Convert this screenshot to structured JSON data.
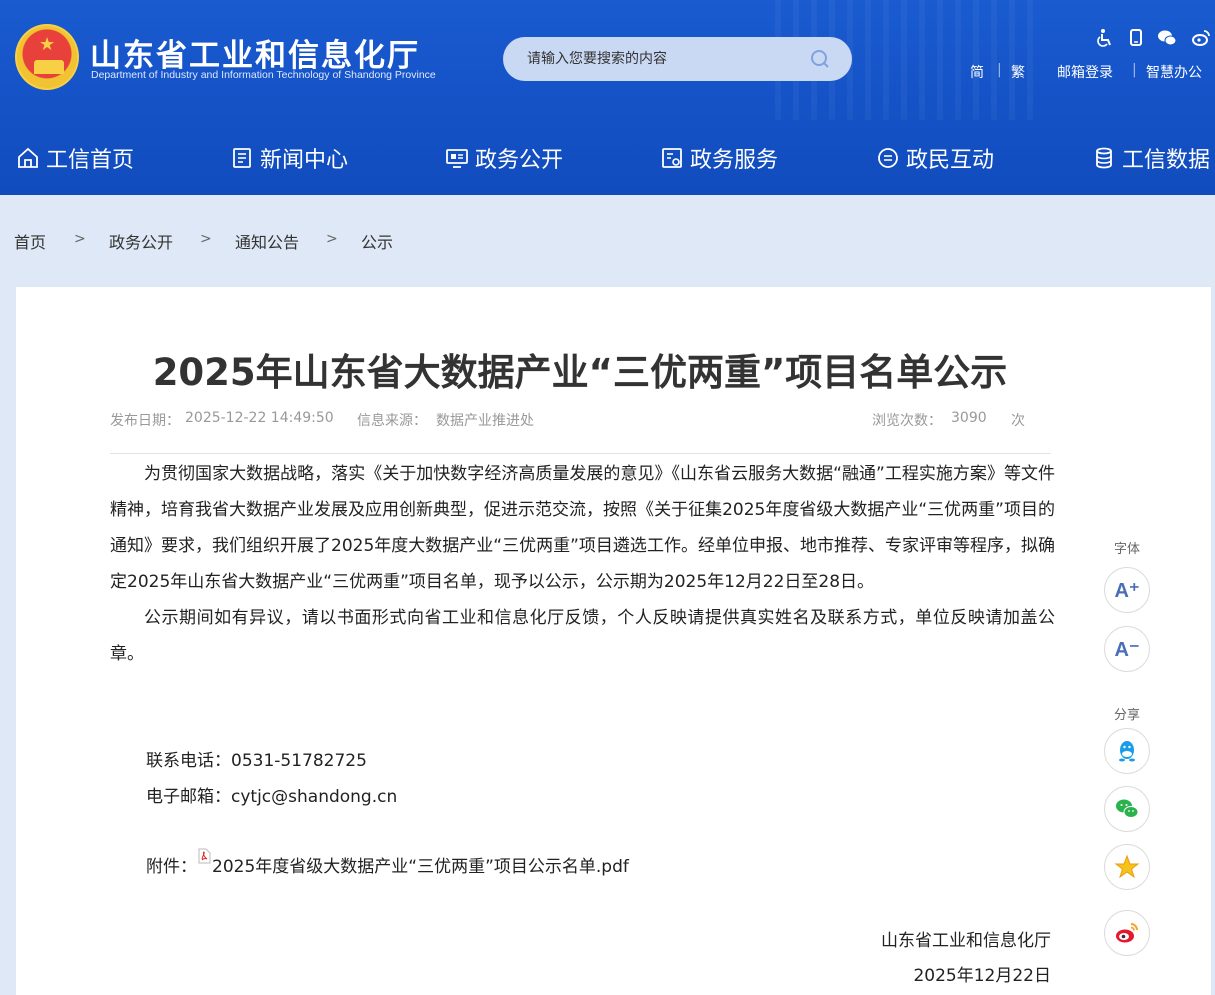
{
  "header": {
    "site_title": "山东省工业和信息化厅",
    "site_subtitle": "Department of Industry and Information Technology of Shandong Province",
    "search_placeholder": "请输入您要搜索的内容",
    "top_icons": [
      "accessibility-icon",
      "mobile-icon",
      "wechat-icon",
      "weibo-icon"
    ],
    "top_links": [
      "简",
      "繁",
      "邮箱登录",
      "智慧办公"
    ]
  },
  "nav": {
    "items": [
      {
        "label": "工信首页",
        "icon": "home-icon"
      },
      {
        "label": "新闻中心",
        "icon": "news-icon"
      },
      {
        "label": "政务公开",
        "icon": "monitor-icon"
      },
      {
        "label": "政务服务",
        "icon": "service-icon"
      },
      {
        "label": "政民互动",
        "icon": "chat-icon"
      },
      {
        "label": "工信数据",
        "icon": "database-icon"
      }
    ]
  },
  "breadcrumb": {
    "items": [
      "首页",
      "政务公开",
      "通知公告",
      "公示"
    ],
    "separator": ">"
  },
  "article": {
    "title": "2025年山东省大数据产业“三优两重”项目名单公示",
    "publish_label": "发布日期：",
    "publish_date": "2025-12-22 14:49:50",
    "source_label": "信息来源：",
    "source": "数据产业推进处",
    "views_label": "浏览次数：",
    "views": "3090",
    "views_unit": "次",
    "paragraphs": [
      "为贯彻国家大数据战略，落实《关于加快数字经济高质量发展的意见》《山东省云服务大数据“融通”工程实施方案》等文件精神，培育我省大数据产业发展及应用创新典型，促进示范交流，按照《关于征集2025年度省级大数据产业“三优两重”项目的通知》要求，我们组织开展了2025年度大数据产业“三优两重”项目遴选工作。经单位申报、地市推荐、专家评审等程序，拟确定2025年山东省大数据产业“三优两重”项目名单，现予以公示，公示期为2025年12月22日至28日。",
      "公示期间如有异议，请以书面形式向省工业和信息化厅反馈，个人反映请提供真实姓名及联系方式，单位反映请加盖公章。"
    ],
    "phone_label": "联系电话：",
    "phone": "0531-51782725",
    "email_label": "电子邮箱：",
    "email": "cytjc@shandong.cn",
    "attachment_label": "附件：",
    "attachment_name": "2025年度省级大数据产业“三优两重”项目公示名单.pdf",
    "signature_org": "山东省工业和信息化厅",
    "signature_date": "2025年12月22日"
  },
  "side_tools": {
    "font_label": "字体",
    "font_increase": "A⁺",
    "font_decrease": "A⁻",
    "share_label": "分享",
    "share_targets": [
      "qq-icon",
      "wechat-icon",
      "qzone-icon",
      "weibo-icon"
    ]
  },
  "colors": {
    "header_blue": "#1452c6",
    "page_bg": "#dfe8f6",
    "search_bg": "#c9d8f3",
    "meta_gray": "#999999"
  }
}
